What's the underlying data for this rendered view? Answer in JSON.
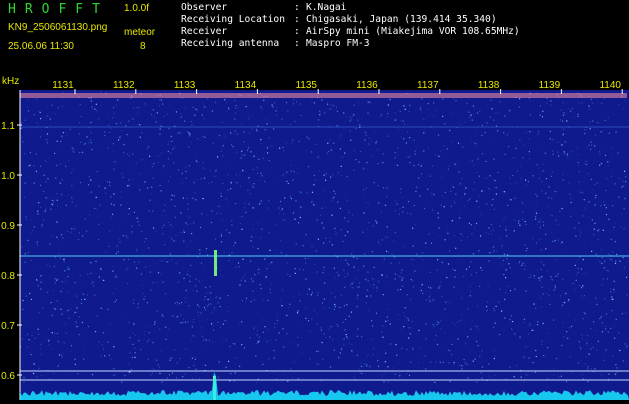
{
  "header": {
    "app_title": "HROFFT",
    "version": "1.0.0f",
    "filename": "KN9_2506061130.png",
    "mode": "meteor",
    "datetime": "25.06.06 11:30",
    "count": "8"
  },
  "station": [
    {
      "key": "Observer",
      "value": "K.Nagai"
    },
    {
      "key": "Receiving Location",
      "value": "Chigasaki, Japan (139.414 35.340)"
    },
    {
      "key": "Receiver",
      "value": "AirSpy mini (Miakejima VOR 108.65MHz)"
    },
    {
      "key": "Receiving antenna",
      "value": "Maspro FM-3"
    }
  ],
  "spectrogram": {
    "y_unit": "kHz",
    "time_ticks": [
      "1131",
      "1132",
      "1133",
      "1134",
      "1135",
      "1136",
      "1137",
      "1138",
      "1139",
      "1140"
    ],
    "freq_ticks": [
      "1.1",
      "1.0",
      "0.9",
      "0.8",
      "0.7",
      "0.6"
    ],
    "colors": {
      "background": "#0f1a8c",
      "noise": "#3a78e8",
      "carrier": "#4fd0ff",
      "tick_text": "#e8e800",
      "meteor": "#7dff7d",
      "spectrum": "#19e8ff"
    }
  }
}
